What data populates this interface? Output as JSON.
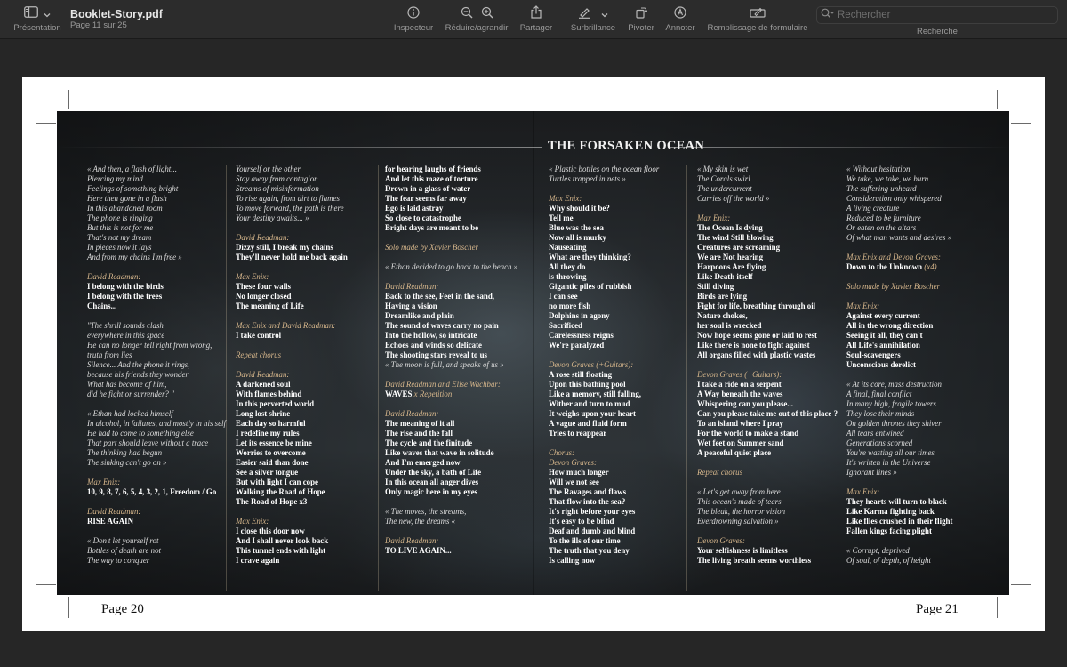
{
  "toolbar": {
    "view_label": "Présentation",
    "doc_title": "Booklet-Story.pdf",
    "doc_subtitle": "Page 11 sur 25",
    "inspector": "Inspecteur",
    "zoom": "Réduire/agrandir",
    "share": "Partager",
    "highlight": "Surbrillance",
    "rotate": "Pivoter",
    "annotate": "Annoter",
    "form_fill": "Remplissage de formulaire",
    "search_placeholder": "Rechercher",
    "search_label": "Recherche"
  },
  "icons": [
    "sidebar-icon",
    "chevron-down-icon",
    "info-icon",
    "zoom-out-icon",
    "zoom-in-icon",
    "share-icon",
    "highlighter-icon",
    "rotate-icon",
    "annotate-icon",
    "form-fill-icon",
    "search-icon"
  ],
  "spread": {
    "title": "THE FORSAKEN OCEAN",
    "page_left": "Page 20",
    "page_right": "Page 21"
  },
  "columns": [
    [
      {
        "s": "i",
        "t": "« And then, a flash of light..."
      },
      {
        "s": "i",
        "t": "Piercing my mind"
      },
      {
        "s": "i",
        "t": "Feelings of something bright"
      },
      {
        "s": "i",
        "t": "Here then gone in a flash"
      },
      {
        "s": "i",
        "t": "In this abandoned room"
      },
      {
        "s": "i",
        "t": "The phone is ringing"
      },
      {
        "s": "i",
        "t": "But this is not for me"
      },
      {
        "s": "i",
        "t": "That's not my dream"
      },
      {
        "s": "i",
        "t": "In pieces now it lays"
      },
      {
        "s": "i",
        "t": "And from my chains I'm free »"
      },
      {
        "s": "gap",
        "t": ""
      },
      {
        "s": "h",
        "t": "David Readman:"
      },
      {
        "s": "b",
        "t": "I belong with the birds"
      },
      {
        "s": "b",
        "t": "I belong with the trees"
      },
      {
        "s": "b",
        "t": "Chains..."
      },
      {
        "s": "gap",
        "t": ""
      },
      {
        "s": "i",
        "t": "\"The shrill sounds clash"
      },
      {
        "s": "i",
        "t": "everywhere in this space"
      },
      {
        "s": "i",
        "t": "He can no longer tell right from wrong,"
      },
      {
        "s": "i",
        "t": "truth from lies"
      },
      {
        "s": "i",
        "t": "Silence... And the phone it rings,"
      },
      {
        "s": "i",
        "t": "because his friends they wonder"
      },
      {
        "s": "i",
        "t": "What has become of him,"
      },
      {
        "s": "i",
        "t": "did he fight or surrender? \""
      },
      {
        "s": "gap",
        "t": ""
      },
      {
        "s": "i",
        "t": "« Ethan had locked himself"
      },
      {
        "s": "i",
        "t": "In alcohol, in failures, and mostly in his self"
      },
      {
        "s": "i",
        "t": "He had to come to something else"
      },
      {
        "s": "i",
        "t": "That part should leave without a trace"
      },
      {
        "s": "i",
        "t": "The thinking had begun"
      },
      {
        "s": "i",
        "t": "The sinking can't go on »"
      },
      {
        "s": "gap",
        "t": ""
      },
      {
        "s": "h",
        "t": "Max Enix:"
      },
      {
        "s": "b",
        "t": "10, 9, 8, 7, 6, 5, 4, 3, 2, 1, Freedom / Go"
      },
      {
        "s": "gap",
        "t": ""
      },
      {
        "s": "h",
        "t": "David Readman:"
      },
      {
        "s": "b",
        "t": "RISE AGAIN"
      },
      {
        "s": "gap",
        "t": ""
      },
      {
        "s": "i",
        "t": "« Don't let yourself rot"
      },
      {
        "s": "i",
        "t": "Bottles of death are not"
      },
      {
        "s": "i",
        "t": "The way to conquer"
      }
    ],
    [
      {
        "s": "i",
        "t": "Yourself or the other"
      },
      {
        "s": "i",
        "t": "Stay away from contagion"
      },
      {
        "s": "i",
        "t": "Streams of misinformation"
      },
      {
        "s": "i",
        "t": "To rise again, from dirt to flames"
      },
      {
        "s": "i",
        "t": "To move forward, the path is there"
      },
      {
        "s": "i",
        "t": "Your destiny awaits... »"
      },
      {
        "s": "gap",
        "t": ""
      },
      {
        "s": "h",
        "t": "David Readman:"
      },
      {
        "s": "b",
        "t": "Dizzy still, I break my chains"
      },
      {
        "s": "b",
        "t": "They'll never hold me back again"
      },
      {
        "s": "gap",
        "t": ""
      },
      {
        "s": "h",
        "t": "Max Enix:"
      },
      {
        "s": "b",
        "t": "These four walls"
      },
      {
        "s": "b",
        "t": "No longer closed"
      },
      {
        "s": "b",
        "t": "The meaning of Life"
      },
      {
        "s": "gap",
        "t": ""
      },
      {
        "s": "h",
        "t": "Max Enix and David Readman:"
      },
      {
        "s": "b",
        "t": "I take control"
      },
      {
        "s": "gap",
        "t": ""
      },
      {
        "s": "h",
        "t": "Repeat chorus"
      },
      {
        "s": "gap",
        "t": ""
      },
      {
        "s": "h",
        "t": "David Readman:"
      },
      {
        "s": "b",
        "t": "A darkened soul"
      },
      {
        "s": "b",
        "t": "With flames behind"
      },
      {
        "s": "b",
        "t": "In this perverted world"
      },
      {
        "s": "b",
        "t": "Long lost shrine"
      },
      {
        "s": "b",
        "t": "Each day so harmful"
      },
      {
        "s": "b",
        "t": "I redefine my rules"
      },
      {
        "s": "b",
        "t": "Let its essence be mine"
      },
      {
        "s": "b",
        "t": "Worries to overcome"
      },
      {
        "s": "b",
        "t": "Easier said than done"
      },
      {
        "s": "b",
        "t": "See a silver tongue"
      },
      {
        "s": "b",
        "t": "But with light I can cope"
      },
      {
        "s": "b",
        "t": "Walking the Road of Hope"
      },
      {
        "s": "b",
        "t": "The Road of Hope x3"
      },
      {
        "s": "gap",
        "t": ""
      },
      {
        "s": "h",
        "t": "Max Enix:"
      },
      {
        "s": "b",
        "t": "I close this door now"
      },
      {
        "s": "b",
        "t": "And I shall never look back"
      },
      {
        "s": "b",
        "t": "This tunnel ends with light"
      },
      {
        "s": "b",
        "t": "I crave again"
      }
    ],
    [
      {
        "s": "b",
        "t": "for hearing laughs of friends"
      },
      {
        "s": "b",
        "t": "And let this maze of torture"
      },
      {
        "s": "b",
        "t": "Drown in a glass of water"
      },
      {
        "s": "b",
        "t": "The fear seems far away"
      },
      {
        "s": "b",
        "t": "Ego is laid astray"
      },
      {
        "s": "b",
        "t": "So close to catastrophe"
      },
      {
        "s": "b",
        "t": "Bright days are meant to be"
      },
      {
        "s": "gap",
        "t": ""
      },
      {
        "s": "h",
        "t": "Solo made by Xavier Boscher"
      },
      {
        "s": "gap",
        "t": ""
      },
      {
        "s": "i",
        "t": "« Ethan decided to go back to the beach »"
      },
      {
        "s": "gap",
        "t": ""
      },
      {
        "s": "h",
        "t": "David Readman:"
      },
      {
        "s": "b",
        "t": "Back to the see, Feet in the sand,"
      },
      {
        "s": "b",
        "t": "Having a vision"
      },
      {
        "s": "b",
        "t": "Dreamlike and plain"
      },
      {
        "s": "b",
        "t": "The sound of waves carry no pain"
      },
      {
        "s": "b",
        "t": "Into the hollow, so intricate"
      },
      {
        "s": "b",
        "t": "Echoes and winds so delicate"
      },
      {
        "s": "b",
        "t": "The shooting stars reveal to us"
      },
      {
        "s": "i",
        "t": "« The moon is full, and speaks of us »"
      },
      {
        "s": "gap",
        "t": ""
      },
      {
        "s": "h",
        "t": "David Readman and Elise Wachbar:"
      },
      {
        "s": "bh",
        "t": "WAVES",
        "t2": " x Repetition"
      },
      {
        "s": "gap",
        "t": ""
      },
      {
        "s": "h",
        "t": "David Readman:"
      },
      {
        "s": "b",
        "t": "The meaning of it all"
      },
      {
        "s": "b",
        "t": "The rise and the fall"
      },
      {
        "s": "b",
        "t": "The cycle and the finitude"
      },
      {
        "s": "b",
        "t": "Like waves that wave in solitude"
      },
      {
        "s": "b",
        "t": "And I'm emerged now"
      },
      {
        "s": "b",
        "t": "Under the sky, a bath of Life"
      },
      {
        "s": "b",
        "t": "In this ocean all anger dives"
      },
      {
        "s": "b",
        "t": "Only magic here in my eyes"
      },
      {
        "s": "gap",
        "t": ""
      },
      {
        "s": "i",
        "t": "« The moves, the streams,"
      },
      {
        "s": "i",
        "t": "The new, the dreams «"
      },
      {
        "s": "gap",
        "t": ""
      },
      {
        "s": "h",
        "t": "David Readman:"
      },
      {
        "s": "b",
        "t": "TO LIVE AGAIN..."
      }
    ],
    [
      {
        "s": "i",
        "t": "« Plastic bottles on the ocean floor"
      },
      {
        "s": "i",
        "t": "Turtles trapped in nets »"
      },
      {
        "s": "gap",
        "t": ""
      },
      {
        "s": "h",
        "t": "Max Enix:"
      },
      {
        "s": "b",
        "t": "Why should it be?"
      },
      {
        "s": "b",
        "t": "Tell me"
      },
      {
        "s": "b",
        "t": "Blue was the sea"
      },
      {
        "s": "b",
        "t": "Now all is murky"
      },
      {
        "s": "b",
        "t": "Nauseating"
      },
      {
        "s": "b",
        "t": "What are they thinking?"
      },
      {
        "s": "b",
        "t": "All they do"
      },
      {
        "s": "b",
        "t": "is throwing"
      },
      {
        "s": "b",
        "t": "Gigantic piles of rubbish"
      },
      {
        "s": "b",
        "t": "I can see"
      },
      {
        "s": "b",
        "t": "no more fish"
      },
      {
        "s": "b",
        "t": "Dolphins in agony"
      },
      {
        "s": "b",
        "t": "Sacrificed"
      },
      {
        "s": "b",
        "t": "Carelessness reigns"
      },
      {
        "s": "b",
        "t": "We're paralyzed"
      },
      {
        "s": "gap",
        "t": ""
      },
      {
        "s": "h",
        "t": "Devon Graves (+Guitars):"
      },
      {
        "s": "b",
        "t": "A rose still floating"
      },
      {
        "s": "b",
        "t": "Upon this bathing pool"
      },
      {
        "s": "b",
        "t": "Like a memory, still falling,"
      },
      {
        "s": "b",
        "t": "Wither and turn to mud"
      },
      {
        "s": "b",
        "t": "It weighs upon your heart"
      },
      {
        "s": "b",
        "t": "A vague and fluid form"
      },
      {
        "s": "b",
        "t": "Tries to reappear"
      },
      {
        "s": "gap",
        "t": ""
      },
      {
        "s": "h",
        "t": "Chorus:"
      },
      {
        "s": "h",
        "t": "Devon Graves:"
      },
      {
        "s": "b",
        "t": "How much longer"
      },
      {
        "s": "b",
        "t": "Will we not see"
      },
      {
        "s": "b",
        "t": "The Ravages and flaws"
      },
      {
        "s": "b",
        "t": "That flow into the sea?"
      },
      {
        "s": "b",
        "t": "It's right before your eyes"
      },
      {
        "s": "b",
        "t": "It's easy to be blind"
      },
      {
        "s": "b",
        "t": "Deaf and dumb and blind"
      },
      {
        "s": "b",
        "t": "To the ills of our time"
      },
      {
        "s": "b",
        "t": "The truth that you deny"
      },
      {
        "s": "b",
        "t": "Is calling now"
      }
    ],
    [
      {
        "s": "i",
        "t": "« My skin is wet"
      },
      {
        "s": "i",
        "t": "The Corals swirl"
      },
      {
        "s": "i",
        "t": "The undercurrent"
      },
      {
        "s": "i",
        "t": "Carries off the world »"
      },
      {
        "s": "gap",
        "t": ""
      },
      {
        "s": "h",
        "t": "Max Enix:"
      },
      {
        "s": "b",
        "t": "The Ocean Is dying"
      },
      {
        "s": "b",
        "t": "The wind Still blowing"
      },
      {
        "s": "b",
        "t": "Creatures are screaming"
      },
      {
        "s": "b",
        "t": "We are Not hearing"
      },
      {
        "s": "b",
        "t": "Harpoons Are flying"
      },
      {
        "s": "b",
        "t": "Like Death itself"
      },
      {
        "s": "b",
        "t": "Still diving"
      },
      {
        "s": "b",
        "t": "Birds are lying"
      },
      {
        "s": "b",
        "t": "Fight for life, breathing through oil"
      },
      {
        "s": "b",
        "t": "Nature chokes,"
      },
      {
        "s": "b",
        "t": "her soul is wrecked"
      },
      {
        "s": "b",
        "t": "Now hope seems gone or laid to rest"
      },
      {
        "s": "b",
        "t": "Like there is none to fight against"
      },
      {
        "s": "b",
        "t": "All organs filled with plastic wastes"
      },
      {
        "s": "gap",
        "t": ""
      },
      {
        "s": "h",
        "t": "Devon Graves (+Guitars):"
      },
      {
        "s": "b",
        "t": "I take a ride on a serpent"
      },
      {
        "s": "b",
        "t": "A Way beneath the waves"
      },
      {
        "s": "b",
        "t": "Whispering can you please..."
      },
      {
        "s": "b",
        "t": "Can you please take me out of this place ?"
      },
      {
        "s": "b",
        "t": "To an island where I pray"
      },
      {
        "s": "b",
        "t": "For the world to make a stand"
      },
      {
        "s": "b",
        "t": "Wet feet on Summer sand"
      },
      {
        "s": "b",
        "t": "A peaceful quiet place"
      },
      {
        "s": "gap",
        "t": ""
      },
      {
        "s": "h",
        "t": "Repeat chorus"
      },
      {
        "s": "gap",
        "t": ""
      },
      {
        "s": "i",
        "t": "« Let's get away from here"
      },
      {
        "s": "i",
        "t": "This ocean's made of tears"
      },
      {
        "s": "i",
        "t": "The bleak, the horror vision"
      },
      {
        "s": "i",
        "t": "Everdrowning salvation »"
      },
      {
        "s": "gap",
        "t": ""
      },
      {
        "s": "h",
        "t": "Devon Graves:"
      },
      {
        "s": "b",
        "t": "Your selfishness is limitless"
      },
      {
        "s": "b",
        "t": "The living breath seems worthless"
      }
    ],
    [
      {
        "s": "i",
        "t": "« Without hesitation"
      },
      {
        "s": "i",
        "t": "We take, we take, we burn"
      },
      {
        "s": "i",
        "t": "The suffering unheard"
      },
      {
        "s": "i",
        "t": "Consideration only whispered"
      },
      {
        "s": "i",
        "t": "A living creature"
      },
      {
        "s": "i",
        "t": "Reduced to be furniture"
      },
      {
        "s": "i",
        "t": "Or eaten on the altars"
      },
      {
        "s": "i",
        "t": "Of what man wants and desires »"
      },
      {
        "s": "gap",
        "t": ""
      },
      {
        "s": "h",
        "t": "Max Enix and Devon Graves:"
      },
      {
        "s": "bh",
        "t": "Down to the Unknown",
        "t2": " (x4)"
      },
      {
        "s": "gap",
        "t": ""
      },
      {
        "s": "h",
        "t": "Solo made by Xavier Boscher"
      },
      {
        "s": "gap",
        "t": ""
      },
      {
        "s": "h",
        "t": "Max Enix:"
      },
      {
        "s": "b",
        "t": "Against every current"
      },
      {
        "s": "b",
        "t": "All in the wrong direction"
      },
      {
        "s": "b",
        "t": "Seeing it all, they can't"
      },
      {
        "s": "b",
        "t": "All Life's annihilation"
      },
      {
        "s": "b",
        "t": "Soul-scavengers"
      },
      {
        "s": "b",
        "t": "Unconscious derelict"
      },
      {
        "s": "gap",
        "t": ""
      },
      {
        "s": "i",
        "t": "« At its core, mass destruction"
      },
      {
        "s": "i",
        "t": "A final, final conflict"
      },
      {
        "s": "i",
        "t": "In many high, fragile towers"
      },
      {
        "s": "i",
        "t": "They lose their minds"
      },
      {
        "s": "i",
        "t": "On golden thrones they shiver"
      },
      {
        "s": "i",
        "t": "All tears entwined"
      },
      {
        "s": "i",
        "t": "Generations scorned"
      },
      {
        "s": "i",
        "t": "You're wasting all our times"
      },
      {
        "s": "i",
        "t": "It's written in the Universe"
      },
      {
        "s": "i",
        "t": "Ignorant lines »"
      },
      {
        "s": "gap",
        "t": ""
      },
      {
        "s": "h",
        "t": "Max Enix:"
      },
      {
        "s": "b",
        "t": "They hearts will turn to black"
      },
      {
        "s": "b",
        "t": "Like Karma fighting back"
      },
      {
        "s": "b",
        "t": "Like flies crushed in their flight"
      },
      {
        "s": "b",
        "t": "Fallen kings facing plight"
      },
      {
        "s": "gap",
        "t": ""
      },
      {
        "s": "i",
        "t": "« Corrupt, deprived"
      },
      {
        "s": "i",
        "t": "Of soul, of depth, of height"
      }
    ]
  ]
}
